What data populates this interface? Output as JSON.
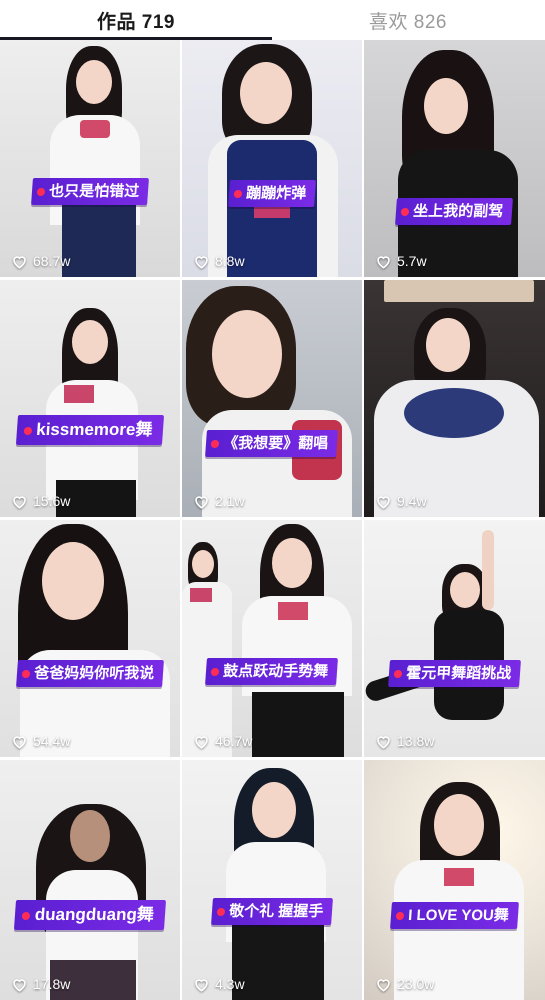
{
  "tabs": {
    "works": "作品 719",
    "likes": "喜欢 826"
  },
  "videos": [
    {
      "caption": "也只是怕错过",
      "likes": "68.7w"
    },
    {
      "caption": "蹦蹦炸弹",
      "likes": "8.8w"
    },
    {
      "caption": "坐上我的副驾",
      "likes": "5.7w"
    },
    {
      "caption": "kissmemore舞",
      "likes": "15.6w"
    },
    {
      "caption": "《我想要》翻唱",
      "likes": "2.1w"
    },
    {
      "caption": "",
      "likes": "9.4w"
    },
    {
      "caption": "爸爸妈妈你听我说",
      "likes": "54.4w"
    },
    {
      "caption": "鼓点跃动手势舞",
      "likes": "46.7w"
    },
    {
      "caption": "霍元甲舞蹈挑战",
      "likes": "13.8w"
    },
    {
      "caption": "duangduang舞",
      "likes": "17.8w"
    },
    {
      "caption": "敬个礼 握握手",
      "likes": "4.3w"
    },
    {
      "caption": "I LOVE YOU舞",
      "likes": "23.0w"
    }
  ],
  "icons": {
    "like": "heart-outline-icon"
  },
  "colors": {
    "caption_bg": "#6a25dc",
    "caption_dot": "#ff2d55",
    "tab_active": "#1a1a1a",
    "tab_inactive": "#9a9a9a"
  }
}
